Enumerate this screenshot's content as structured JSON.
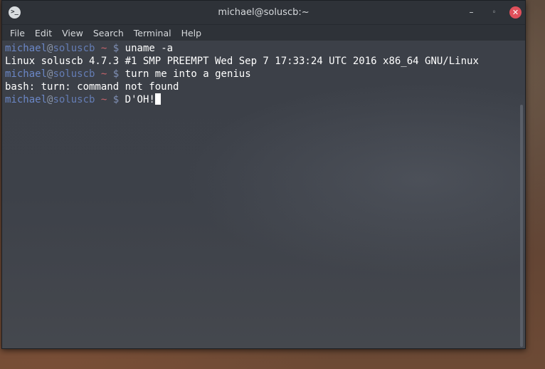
{
  "window": {
    "title": "michael@soluscb:~",
    "app_icon": ">_",
    "controls": {
      "minimize": "–",
      "maximize": "◦",
      "close": "✕"
    }
  },
  "menu": [
    "File",
    "Edit",
    "View",
    "Search",
    "Terminal",
    "Help"
  ],
  "terminal": {
    "prompt": {
      "user": "michael",
      "at": "@",
      "host": "soluscb",
      "path": "~",
      "symbol": "$"
    },
    "lines": [
      {
        "type": "prompt",
        "command": "uname -a"
      },
      {
        "type": "output",
        "text": "Linux soluscb 4.7.3 #1 SMP PREEMPT Wed Sep 7 17:33:24 UTC 2016 x86_64 GNU/Linux"
      },
      {
        "type": "prompt",
        "command": "turn me into a genius"
      },
      {
        "type": "output",
        "text": "bash: turn: command not found"
      },
      {
        "type": "prompt",
        "command": "D'OH!"
      }
    ]
  }
}
